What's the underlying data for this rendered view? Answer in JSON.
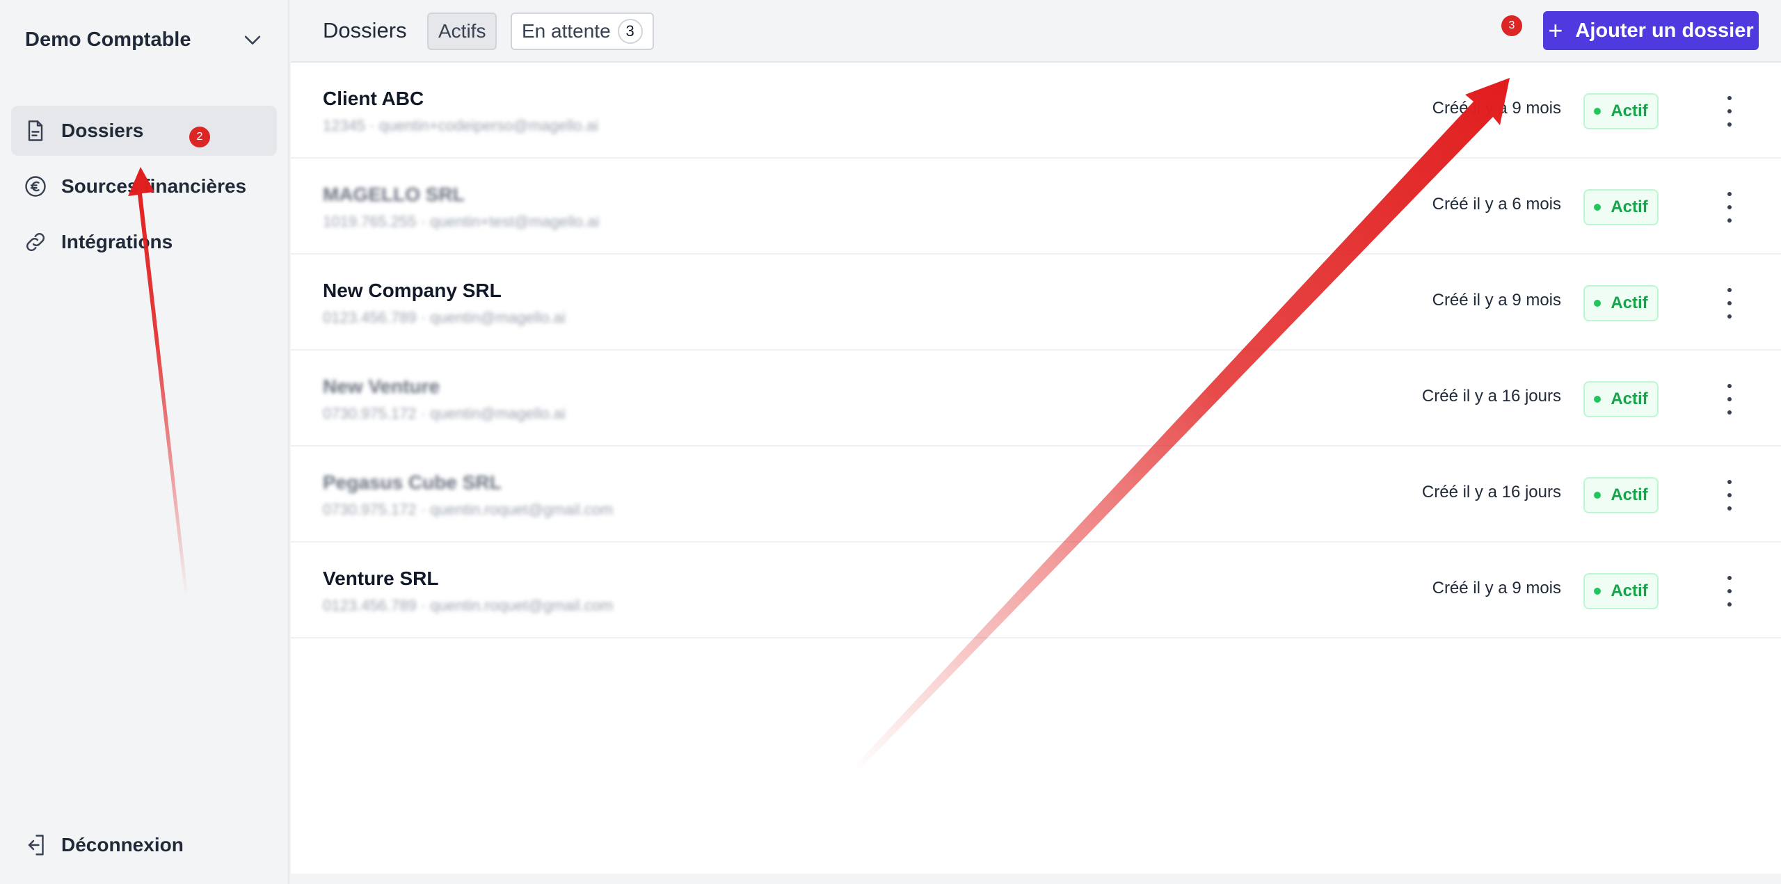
{
  "sidebar": {
    "org_name": "Demo Comptable",
    "items": [
      {
        "label": "Dossiers",
        "icon": "document-icon"
      },
      {
        "label": "Sources financières",
        "icon": "euro-icon"
      },
      {
        "label": "Intégrations",
        "icon": "link-icon"
      }
    ],
    "logout_label": "Déconnexion"
  },
  "header": {
    "title": "Dossiers",
    "tabs": [
      {
        "label": "Actifs"
      },
      {
        "label": "En attente",
        "count": "3"
      }
    ],
    "add_button_label": "Ajouter un dossier"
  },
  "dossiers": [
    {
      "name": "Client ABC",
      "subtitle": "12345 · quentin+codeiperso@magello.ai",
      "created": "Créé il y a 9 mois",
      "status": "Actif"
    },
    {
      "name": "MAGELLO SRL",
      "subtitle": "1019.765.255 · quentin+test@magello.ai",
      "created": "Créé il y a 6 mois",
      "status": "Actif"
    },
    {
      "name": "New Company SRL",
      "subtitle": "0123.456.789 · quentin@magello.ai",
      "created": "Créé il y a 9 mois",
      "status": "Actif"
    },
    {
      "name": "New Venture",
      "subtitle": "0730.975.172 · quentin@magello.ai",
      "created": "Créé il y a 16 jours",
      "status": "Actif"
    },
    {
      "name": "Pegasus Cube SRL",
      "subtitle": "0730.975.172 · quentin.roquet@gmail.com",
      "created": "Créé il y a 16 jours",
      "status": "Actif"
    },
    {
      "name": "Venture SRL",
      "subtitle": "0123.456.789 · quentin.roquet@gmail.com",
      "created": "Créé il y a 9 mois",
      "status": "Actif"
    }
  ],
  "annotations": {
    "step_sidebar": "2",
    "step_add": "3",
    "arrow_color": "#e11d1d"
  },
  "colors": {
    "accent": "#4f3ae0",
    "status_green": "#16a34a"
  }
}
